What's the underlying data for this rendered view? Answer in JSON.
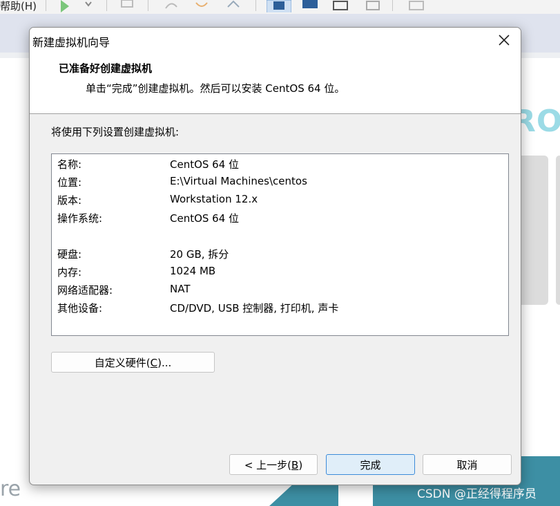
{
  "background": {
    "menu_text": "帮助(H)",
    "ro_text": "RO",
    "brand_tail": "re",
    "watermark": "CSDN @正经得程序员"
  },
  "dialog": {
    "title": "新建虚拟机向导",
    "header_title": "已准备好创建虚拟机",
    "header_subtitle": "单击“完成”创建虚拟机。然后可以安装 CentOS 64 位。",
    "section_label": "将使用下列设置创建虚拟机:",
    "settings": [
      {
        "key": "名称:",
        "value": "CentOS 64 位"
      },
      {
        "key": "位置:",
        "value": "E:\\Virtual Machines\\centos"
      },
      {
        "key": "版本:",
        "value": "Workstation 12.x"
      },
      {
        "key": "操作系统:",
        "value": "CentOS 64 位"
      },
      {
        "key": "硬盘:",
        "value": "20 GB, 拆分"
      },
      {
        "key": "内存:",
        "value": "1024 MB"
      },
      {
        "key": "网络适配器:",
        "value": "NAT"
      },
      {
        "key": "其他设备:",
        "value": "CD/DVD, USB 控制器, 打印机, 声卡"
      }
    ],
    "buttons": {
      "customize_pre": "自定义硬件(",
      "customize_key": "C",
      "customize_post": ")...",
      "back_pre": "< 上一步(",
      "back_key": "B",
      "back_post": ")",
      "finish": "完成",
      "cancel": "取消"
    }
  },
  "colors": {
    "accent": "#3c8bd9",
    "finish_bg": "#e0eef9"
  },
  "icons": [
    "close-icon",
    "play-icon",
    "toolbar-icon"
  ]
}
